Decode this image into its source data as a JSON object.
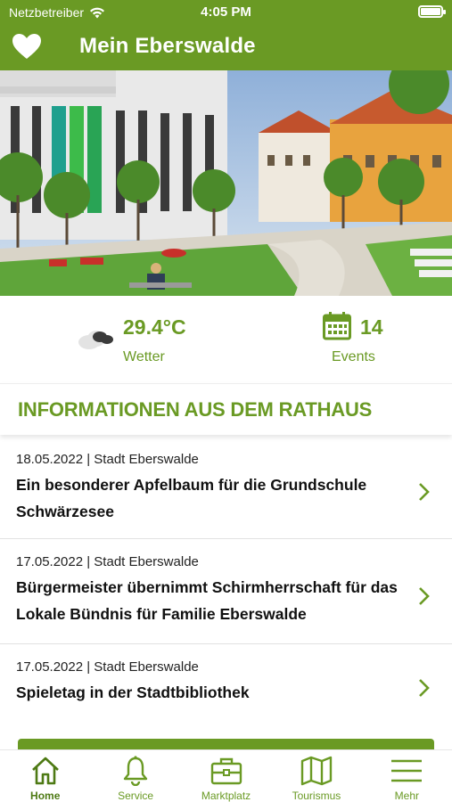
{
  "status_bar": {
    "carrier": "Netzbetreiber",
    "time": "4:05 PM"
  },
  "app_bar": {
    "title": "Mein Eberswalde",
    "icon": "heart-icon"
  },
  "hero": {
    "description_icon": "city-photo"
  },
  "widgets": {
    "weather": {
      "value": "29.4°C",
      "label": "Wetter",
      "icon": "cloud-icon"
    },
    "events": {
      "value": "14",
      "label": "Events",
      "icon": "calendar-icon"
    }
  },
  "section": {
    "title": "INFORMATIONEN AUS DEM RATHAUS"
  },
  "news": [
    {
      "meta": "18.05.2022 | Stadt Eberswalde",
      "headline": "Ein besonderer Apfelbaum für die Grundschule Schwärzesee"
    },
    {
      "meta": "17.05.2022 | Stadt Eberswalde",
      "headline": "Bürgermeister übernimmt Schirmherrschaft für das Lokale Bündnis für Familie Eberswalde"
    },
    {
      "meta": "17.05.2022 | Stadt Eberswalde",
      "headline": "Spieletag in der Stadtbibliothek"
    }
  ],
  "tabs": [
    {
      "label": "Home",
      "icon": "home-icon",
      "active": true
    },
    {
      "label": "Service",
      "icon": "bell-icon",
      "active": false
    },
    {
      "label": "Marktplatz",
      "icon": "briefcase-icon",
      "active": false
    },
    {
      "label": "Tourismus",
      "icon": "map-icon",
      "active": false
    },
    {
      "label": "Mehr",
      "icon": "menu-icon",
      "active": false
    }
  ],
  "colors": {
    "brand_green": "#6a9a24",
    "text": "#111111",
    "divider": "#e2e2e2"
  }
}
